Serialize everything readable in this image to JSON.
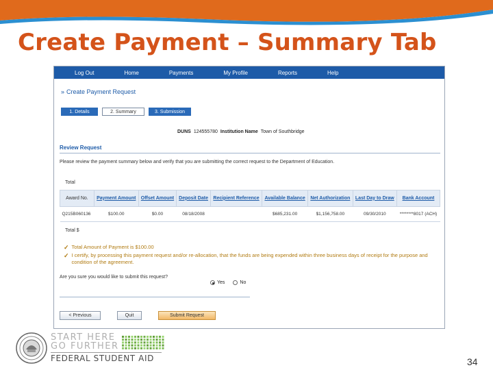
{
  "slide": {
    "title": "Create Payment – Summary Tab",
    "page_number": "34"
  },
  "colors": {
    "title": "#d4531a",
    "nav": "#1d5ba8",
    "swoosh_orange": "#e06a1c",
    "swoosh_blue": "#2b8fd1",
    "note": "#b07a10"
  },
  "app": {
    "nav": [
      "Log Out",
      "Home",
      "Payments",
      "My Profile",
      "Reports",
      "Help"
    ],
    "page_heading": "Create Payment Request",
    "steps": [
      "1. Details",
      "2. Summary",
      "3. Submission"
    ],
    "duns_label": "DUNS",
    "duns_value": "124555780",
    "institution_label": "Institution Name",
    "institution_value": "Town of Southbridge",
    "review_title": "Review Request",
    "instructions": "Please review the payment summary below and verify that you are submitting the correct request to the Department of Education.",
    "total_top": "Total",
    "table": {
      "headers": [
        "Award No.",
        "Payment Amount",
        "Offset Amount",
        "Deposit Date",
        "Recipient Reference",
        "Available Balance",
        "Net Authorization",
        "Last Day to Draw",
        "Bank Account"
      ],
      "rows": [
        [
          "Q215B060136",
          "$100.00",
          "$0.00",
          "08/18/2008",
          "",
          "$685,231.00",
          "$1,156,758.00",
          "09/30/2010",
          "********8017 (ACH)"
        ]
      ]
    },
    "total_bottom": "Total $",
    "notes": [
      "Total Amount of Payment is $100.00",
      "I certify, by processing this payment request and/or re-allocation, that the funds are being expended within three business days of receipt for the purpose and condition of the agreement."
    ],
    "question": "Are you sure you would like to submit this request?",
    "radio_yes": "Yes",
    "radio_no": "No",
    "buttons": {
      "previous": "< Previous",
      "quit": "Quit",
      "submit": "Submit Request"
    }
  },
  "footer": {
    "brand_line1": "START HERE",
    "brand_line2": "GO FURTHER",
    "brand_line3": "FEDERAL STUDENT AID",
    "logo_icon": "department-of-education-seal-icon"
  }
}
